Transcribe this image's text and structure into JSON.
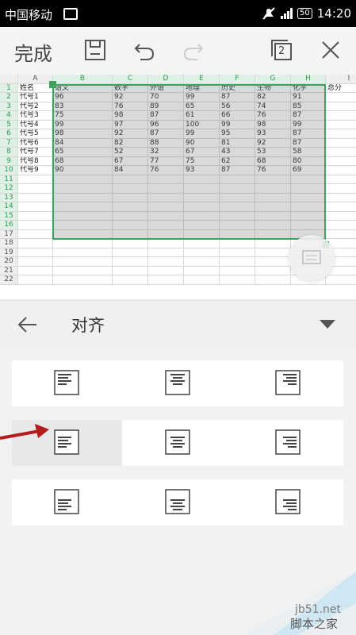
{
  "status": {
    "carrier": "中国移动",
    "battery": "50",
    "time": "14:20"
  },
  "toolbar": {
    "done_label": "完成",
    "tab_count": "2"
  },
  "sheet": {
    "columns": [
      "A",
      "B",
      "C",
      "D",
      "E",
      "F",
      "G",
      "H",
      "I"
    ],
    "row_numbers": [
      "1",
      "2",
      "3",
      "4",
      "5",
      "6",
      "7",
      "8",
      "9",
      "10",
      "11",
      "12",
      "13",
      "14",
      "15",
      "16",
      "17",
      "18",
      "19",
      "20",
      "21",
      "22"
    ],
    "header_row": [
      "姓名",
      "语文",
      "数学",
      "外语",
      "地理",
      "历史",
      "生物",
      "化学",
      "总分"
    ],
    "rows": [
      [
        "代号1",
        "96",
        "92",
        "70",
        "99",
        "87",
        "82",
        "91"
      ],
      [
        "代号2",
        "83",
        "76",
        "89",
        "65",
        "56",
        "74",
        "85"
      ],
      [
        "代号3",
        "75",
        "98",
        "87",
        "61",
        "66",
        "76",
        "87"
      ],
      [
        "代号4",
        "99",
        "97",
        "96",
        "100",
        "99",
        "98",
        "99"
      ],
      [
        "代号5",
        "98",
        "92",
        "87",
        "99",
        "95",
        "93",
        "87"
      ],
      [
        "代号6",
        "84",
        "82",
        "88",
        "90",
        "81",
        "92",
        "87"
      ],
      [
        "代号7",
        "65",
        "52",
        "32",
        "67",
        "43",
        "53",
        "58"
      ],
      [
        "代号8",
        "68",
        "67",
        "77",
        "75",
        "62",
        "68",
        "80"
      ],
      [
        "代号9",
        "90",
        "84",
        "76",
        "93",
        "87",
        "76",
        "69"
      ]
    ]
  },
  "panel": {
    "title": "对齐"
  },
  "watermark": {
    "site": "jb51.net",
    "name": "脚本之家"
  }
}
